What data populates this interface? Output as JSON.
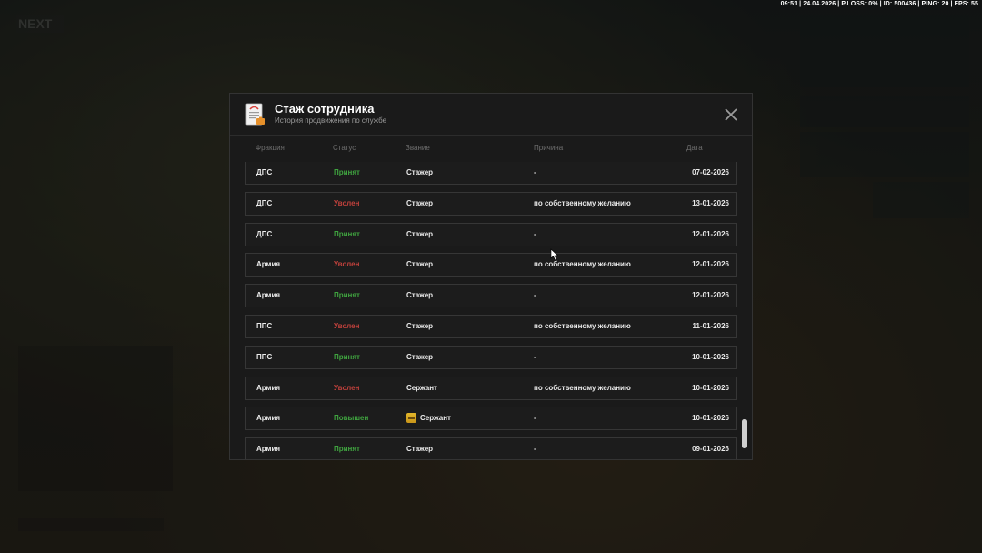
{
  "hud": {
    "status_line": "09:51 | 24.04.2026 | P.LOSS: 0% | ID: 500436 | PING: 20 | FPS: 55"
  },
  "modal": {
    "title": "Стаж сотрудника",
    "subtitle": "История продвижения по службе"
  },
  "table": {
    "headers": {
      "faction": "Фракция",
      "status": "Статус",
      "rank": "Звание",
      "reason": "Причина",
      "date": "Дата"
    },
    "rows": [
      {
        "faction": "ДПС",
        "status": "Принят",
        "status_color": "#3fa33f",
        "rank": "Стажер",
        "reason": "-",
        "date": "07-02-2026"
      },
      {
        "faction": "ДПС",
        "status": "Уволен",
        "status_color": "#c0413c",
        "rank": "Стажер",
        "reason": "по собственному желанию",
        "date": "13-01-2026"
      },
      {
        "faction": "ДПС",
        "status": "Принят",
        "status_color": "#3fa33f",
        "rank": "Стажер",
        "reason": "-",
        "date": "12-01-2026"
      },
      {
        "faction": "Армия",
        "status": "Уволен",
        "status_color": "#c0413c",
        "rank": "Стажер",
        "reason": "по собственному желанию",
        "date": "12-01-2026"
      },
      {
        "faction": "Армия",
        "status": "Принят",
        "status_color": "#3fa33f",
        "rank": "Стажер",
        "reason": "-",
        "date": "12-01-2026"
      },
      {
        "faction": "ППС",
        "status": "Уволен",
        "status_color": "#c0413c",
        "rank": "Стажер",
        "reason": "по собственному желанию",
        "date": "11-01-2026"
      },
      {
        "faction": "ППС",
        "status": "Принят",
        "status_color": "#3fa33f",
        "rank": "Стажер",
        "reason": "-",
        "date": "10-01-2026"
      },
      {
        "faction": "Армия",
        "status": "Уволен",
        "status_color": "#c0413c",
        "rank": "Сержант",
        "reason": "по собственному желанию",
        "date": "10-01-2026"
      },
      {
        "faction": "Армия",
        "status": "Повышен",
        "status_color": "#3fa33f",
        "rank": "Сержант",
        "rank_icon": "rank-badge-icon",
        "reason": "-",
        "date": "10-01-2026"
      },
      {
        "faction": "Армия",
        "status": "Принят",
        "status_color": "#3fa33f",
        "rank": "Стажер",
        "reason": "-",
        "date": "09-01-2026"
      }
    ]
  },
  "icons": {
    "header": "document-icon",
    "close": "close-icon"
  }
}
